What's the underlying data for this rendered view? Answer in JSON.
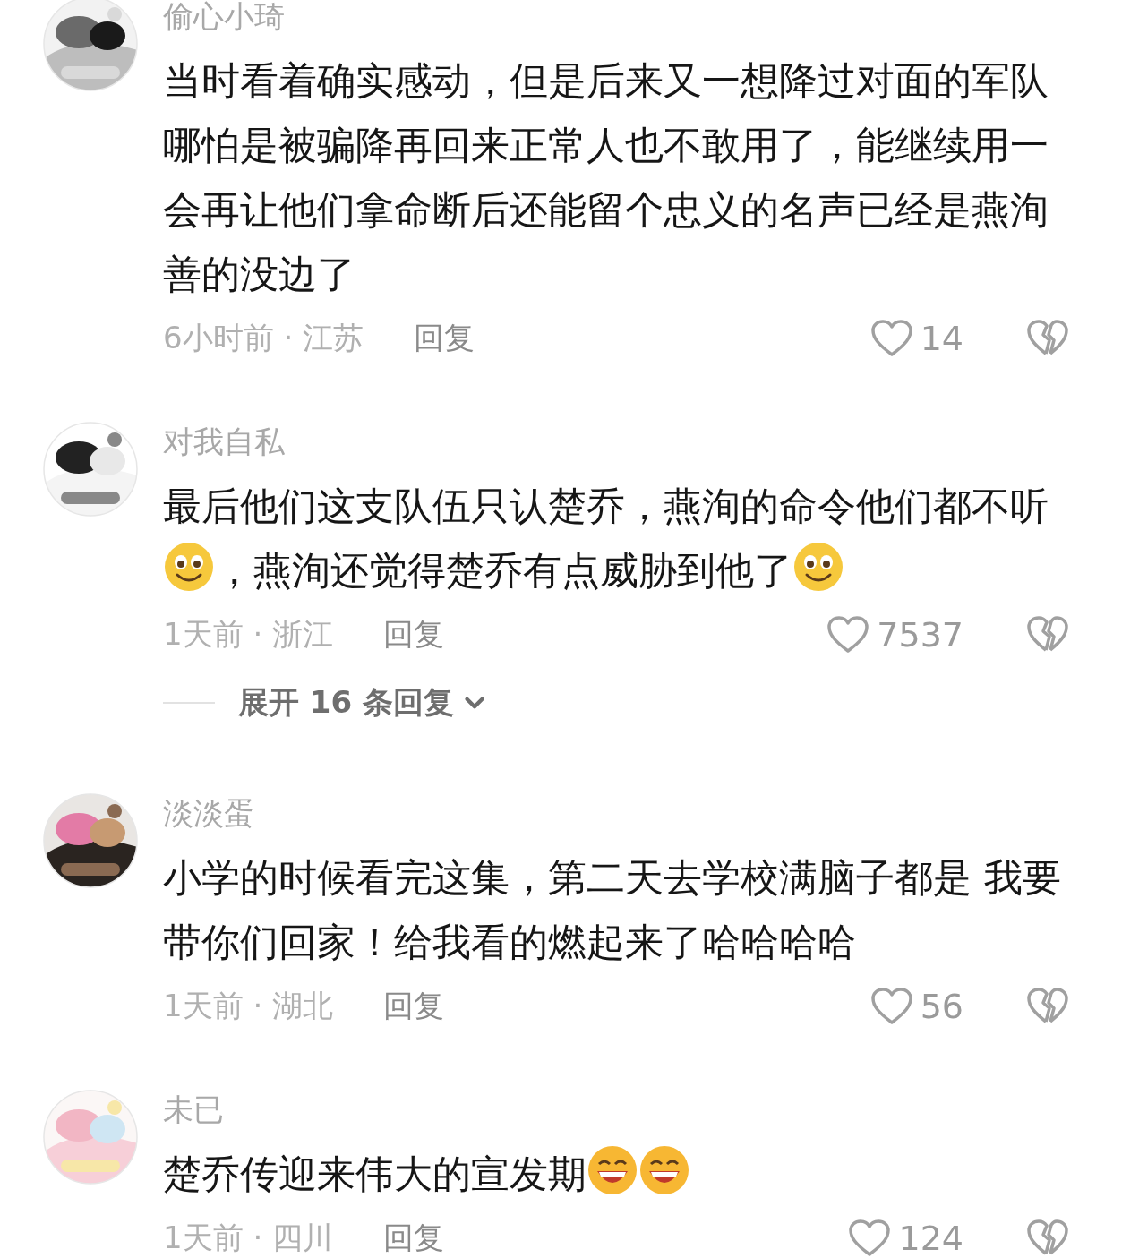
{
  "comments": [
    {
      "avatar": {
        "kind": "picture"
      },
      "name": "偷心小琦",
      "segments": [
        {
          "kind": "text",
          "text": "当时看着确实感动，但是后来又一想降过对面的军队哪怕是被骗降再回来正常人也不敢用了，能继续用一会再让他们拿命断后还能留个忠义的名声已经是燕洵善的没边了"
        }
      ],
      "time_location": "6小时前 · 江苏",
      "reply": "回复",
      "likes": "14"
    },
    {
      "avatar": {
        "kind": "picture"
      },
      "name": "对我自私",
      "segments": [
        {
          "kind": "text",
          "text": "最后他们这支队伍只认楚乔，燕洵的命令他们都不听"
        },
        {
          "kind": "smile"
        },
        {
          "kind": "text",
          "text": "，燕洵还觉得楚乔有点威胁到他了"
        },
        {
          "kind": "smile"
        }
      ],
      "time_location": "1天前 · 浙江",
      "reply": "回复",
      "likes": "7537",
      "expand": "展开 16 条回复"
    },
    {
      "avatar": {
        "kind": "picture"
      },
      "name": "淡淡蛋",
      "segments": [
        {
          "kind": "text",
          "text": "小学的时候看完这集，第二天去学校满脑子都是 我要带你们回家！给我看的燃起来了哈哈哈哈"
        }
      ],
      "time_location": "1天前 · 湖北",
      "reply": "回复",
      "likes": "56"
    },
    {
      "avatar": {
        "kind": "picture"
      },
      "name": "未已",
      "segments": [
        {
          "kind": "text",
          "text": "楚乔传迎来伟大的宣发期"
        },
        {
          "kind": "grin"
        },
        {
          "kind": "grin"
        }
      ],
      "time_location": "1天前 · 四川",
      "reply": "回复",
      "likes": "124"
    }
  ]
}
